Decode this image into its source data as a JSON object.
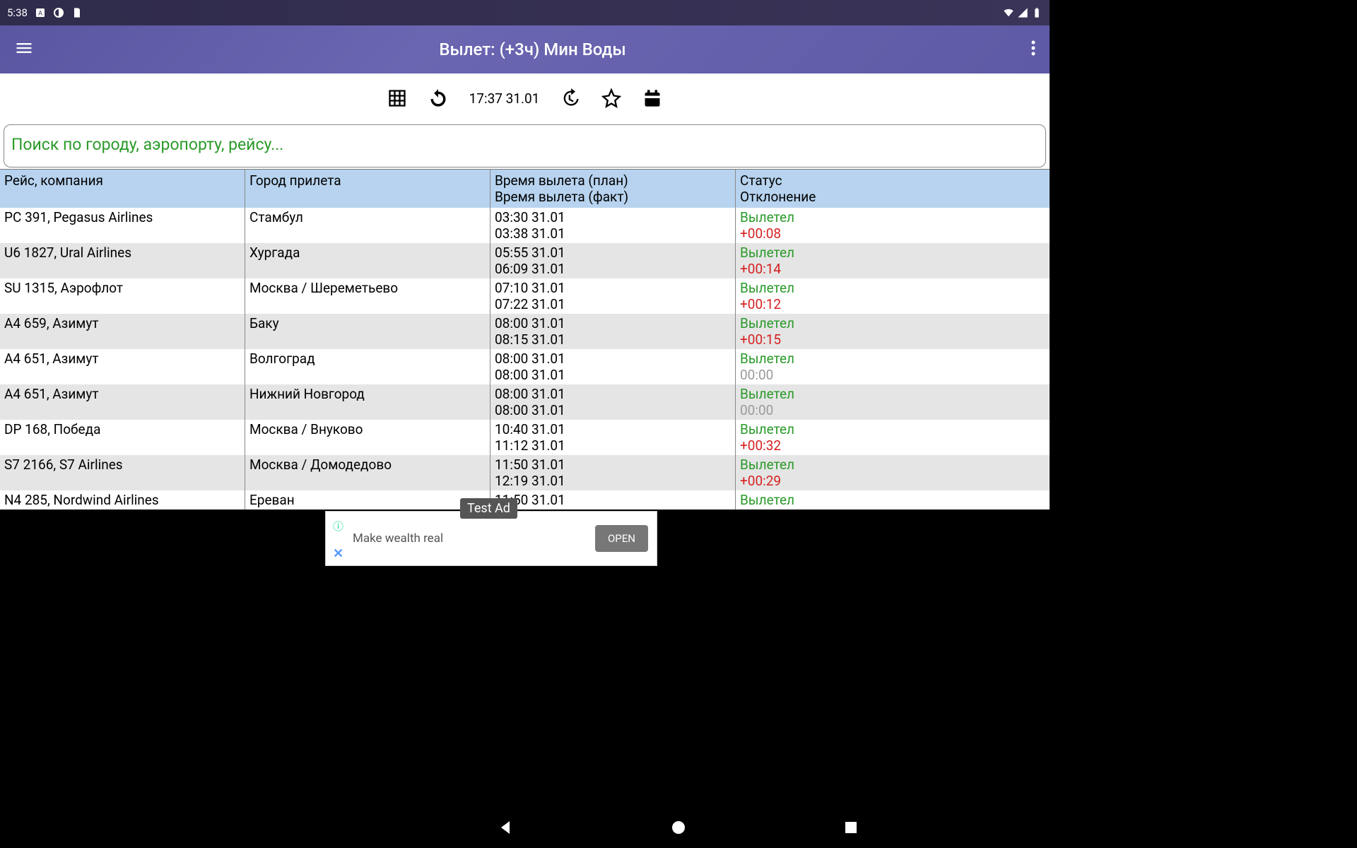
{
  "statusbar": {
    "time": "5:38"
  },
  "header": {
    "title": "Вылет: (+3ч) Мин Воды"
  },
  "toolbar": {
    "datetime": "17:37 31.01"
  },
  "search": {
    "placeholder": "Поиск по городу, аэропорту, рейсу..."
  },
  "table": {
    "headers": {
      "flight": "Рейс, компания",
      "city": "Город прилета",
      "time1": "Время вылета (план)",
      "time2": "Время вылета (факт)",
      "status": "Статус",
      "deviation": "Отклонение"
    },
    "rows": [
      {
        "flight": "PC 391, Pegasus Airlines",
        "city": "Стамбул",
        "tplan": "03:30 31.01",
        "tfact": "03:38 31.01",
        "status": "Вылетел",
        "dev": "+00:08",
        "devclass": "late"
      },
      {
        "flight": "U6 1827, Ural Airlines",
        "city": "Хургада",
        "tplan": "05:55 31.01",
        "tfact": "06:09 31.01",
        "status": "Вылетел",
        "dev": "+00:14",
        "devclass": "late"
      },
      {
        "flight": "SU 1315, Аэрофлот",
        "city": "Москва / Шереметьево",
        "tplan": "07:10 31.01",
        "tfact": "07:22 31.01",
        "status": "Вылетел",
        "dev": "+00:12",
        "devclass": "late"
      },
      {
        "flight": "A4 659, Азимут",
        "city": "Баку",
        "tplan": "08:00 31.01",
        "tfact": "08:15 31.01",
        "status": "Вылетел",
        "dev": "+00:15",
        "devclass": "late"
      },
      {
        "flight": "A4 651, Азимут",
        "city": "Волгоград",
        "tplan": "08:00 31.01",
        "tfact": "08:00 31.01",
        "status": "Вылетел",
        "dev": "00:00",
        "devclass": "zero"
      },
      {
        "flight": "A4 651, Азимут",
        "city": "Нижний Новгород",
        "tplan": "08:00 31.01",
        "tfact": "08:00 31.01",
        "status": "Вылетел",
        "dev": "00:00",
        "devclass": "zero"
      },
      {
        "flight": "DP 168, Победа",
        "city": "Москва / Внуково",
        "tplan": "10:40 31.01",
        "tfact": "11:12 31.01",
        "status": "Вылетел",
        "dev": "+00:32",
        "devclass": "late"
      },
      {
        "flight": "S7 2166, S7 Airlines",
        "city": "Москва / Домодедово",
        "tplan": "11:50 31.01",
        "tfact": "12:19 31.01",
        "status": "Вылетел",
        "dev": "+00:29",
        "devclass": "late"
      },
      {
        "flight": "N4 285, Nordwind Airlines",
        "city": "Ереван",
        "tplan": "11:50 31.01",
        "tfact": "",
        "status": "Вылетел",
        "dev": "",
        "devclass": ""
      }
    ]
  },
  "ad": {
    "label": "Test Ad",
    "text": "Make wealth real",
    "button": "OPEN"
  }
}
